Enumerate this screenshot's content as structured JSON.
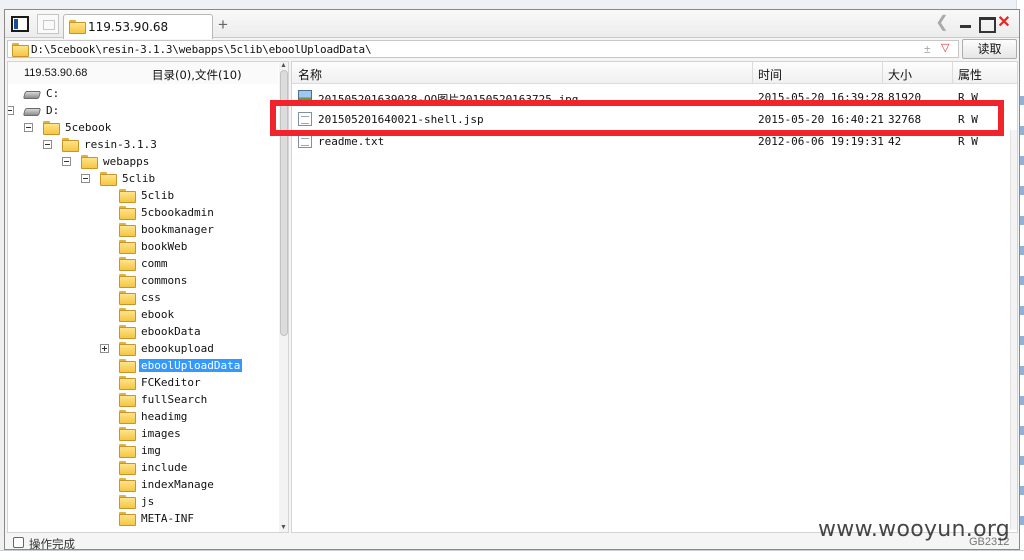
{
  "tab": {
    "title": "119.53.90.68"
  },
  "toolbar": {
    "new_tab": "+"
  },
  "address": {
    "path": "D:\\5cebook\\resin-3.1.3\\webapps\\5clib\\eboolUploadData\\",
    "plusminus": "±",
    "dropdown": "▽",
    "read_button": "读取"
  },
  "tree": {
    "host": "119.53.90.68",
    "stats": "目录(0),文件(10)",
    "items": [
      {
        "label": "C:",
        "type": "drive"
      },
      {
        "label": "D:",
        "type": "drive"
      },
      {
        "label": "5cebook",
        "type": "folder"
      },
      {
        "label": "resin-3.1.3",
        "type": "folder"
      },
      {
        "label": "webapps",
        "type": "folder"
      },
      {
        "label": "5clib",
        "type": "folder"
      },
      {
        "label": "5clib",
        "type": "folder"
      },
      {
        "label": "5cbookadmin",
        "type": "folder"
      },
      {
        "label": "bookmanager",
        "type": "folder"
      },
      {
        "label": "bookWeb",
        "type": "folder"
      },
      {
        "label": "comm",
        "type": "folder"
      },
      {
        "label": "commons",
        "type": "folder"
      },
      {
        "label": "css",
        "type": "folder"
      },
      {
        "label": "ebook",
        "type": "folder"
      },
      {
        "label": "ebookData",
        "type": "folder"
      },
      {
        "label": "ebookupload",
        "type": "folder"
      },
      {
        "label": "eboolUploadData",
        "type": "folder",
        "selected": true
      },
      {
        "label": "FCKeditor",
        "type": "folder"
      },
      {
        "label": "fullSearch",
        "type": "folder"
      },
      {
        "label": "headimg",
        "type": "folder"
      },
      {
        "label": "images",
        "type": "folder"
      },
      {
        "label": "img",
        "type": "folder"
      },
      {
        "label": "include",
        "type": "folder"
      },
      {
        "label": "indexManage",
        "type": "folder"
      },
      {
        "label": "js",
        "type": "folder"
      },
      {
        "label": "META-INF",
        "type": "folder"
      }
    ]
  },
  "files": {
    "columns": {
      "name": "名称",
      "time": "时间",
      "size": "大小",
      "attr": "属性"
    },
    "rows": [
      {
        "name": "201505201639028-QQ图片20150520163725.jpg",
        "time": "2015-05-20 16:39:28",
        "size": "81920",
        "attr": "R W",
        "icon": "image-file-icon"
      },
      {
        "name": "201505201640021-shell.jsp",
        "time": "2015-05-20 16:40:21",
        "size": "32768",
        "attr": "R W",
        "icon": "doc-file-icon"
      },
      {
        "name": "readme.txt",
        "time": "2012-06-06 19:19:31",
        "size": "42",
        "attr": "R W",
        "icon": "doc-file-icon"
      }
    ]
  },
  "status": {
    "text": "操作完成",
    "encoding": "GB2312"
  },
  "watermark": "www.wooyun.org",
  "colors": {
    "highlight": "#f0242a",
    "selection": "#3399ff",
    "folder": "#f5c542"
  }
}
